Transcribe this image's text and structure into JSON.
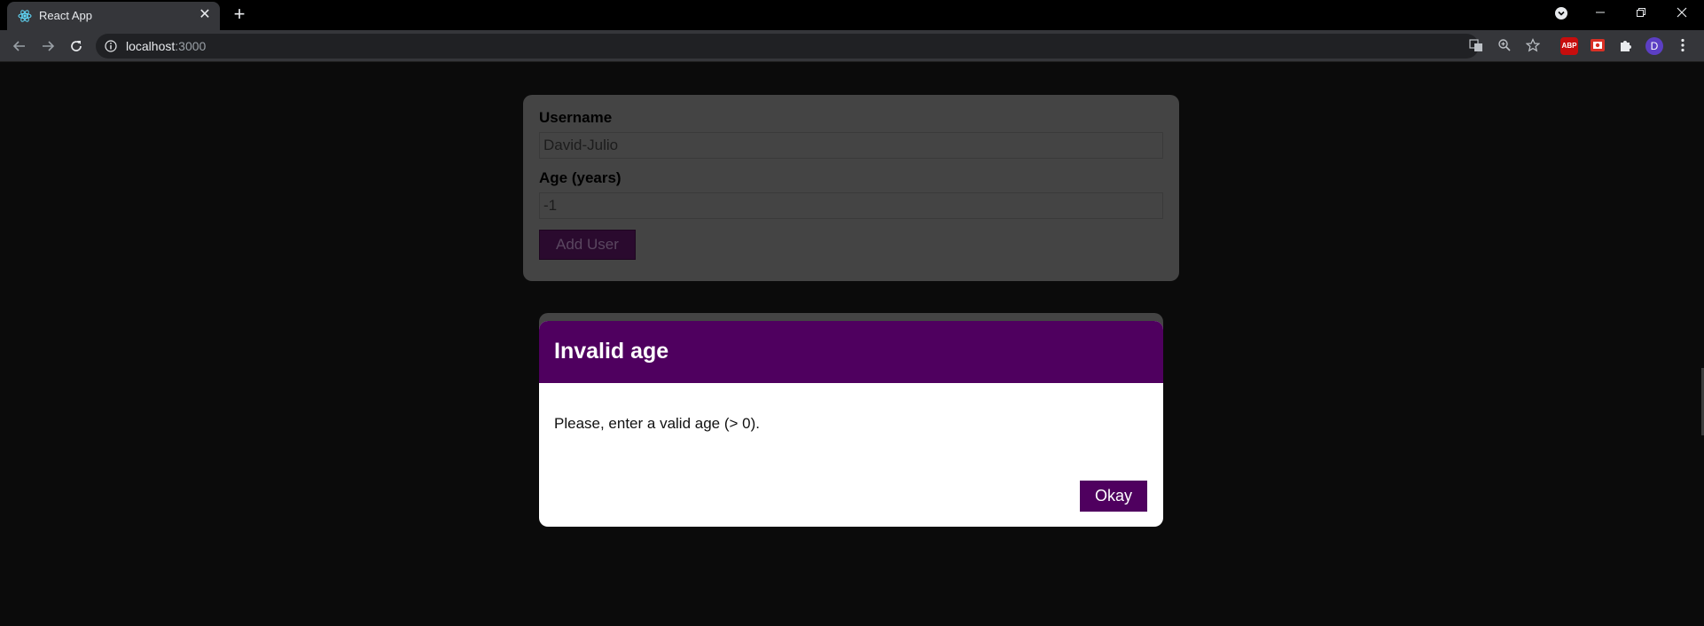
{
  "browser": {
    "tab_title": "React App",
    "tab_close": "✕",
    "new_tab": "+",
    "url_host": "localhost",
    "url_port": ":3000",
    "back_icon": "arrow-left-icon",
    "forward_icon": "arrow-right-icon",
    "reload_icon": "reload-icon",
    "profile_initial": "D",
    "abp_label": "ABP"
  },
  "form": {
    "username_label": "Username",
    "username_value": "David-Julio",
    "age_label": "Age (years)",
    "age_value": "-1",
    "submit_label": "Add User"
  },
  "modal": {
    "title": "Invalid age",
    "message": "Please, enter a valid age (> 0).",
    "confirm_label": "Okay"
  },
  "colors": {
    "modal_header": "#4f005f",
    "backdrop": "#0b0b0b",
    "card": "#444444"
  }
}
